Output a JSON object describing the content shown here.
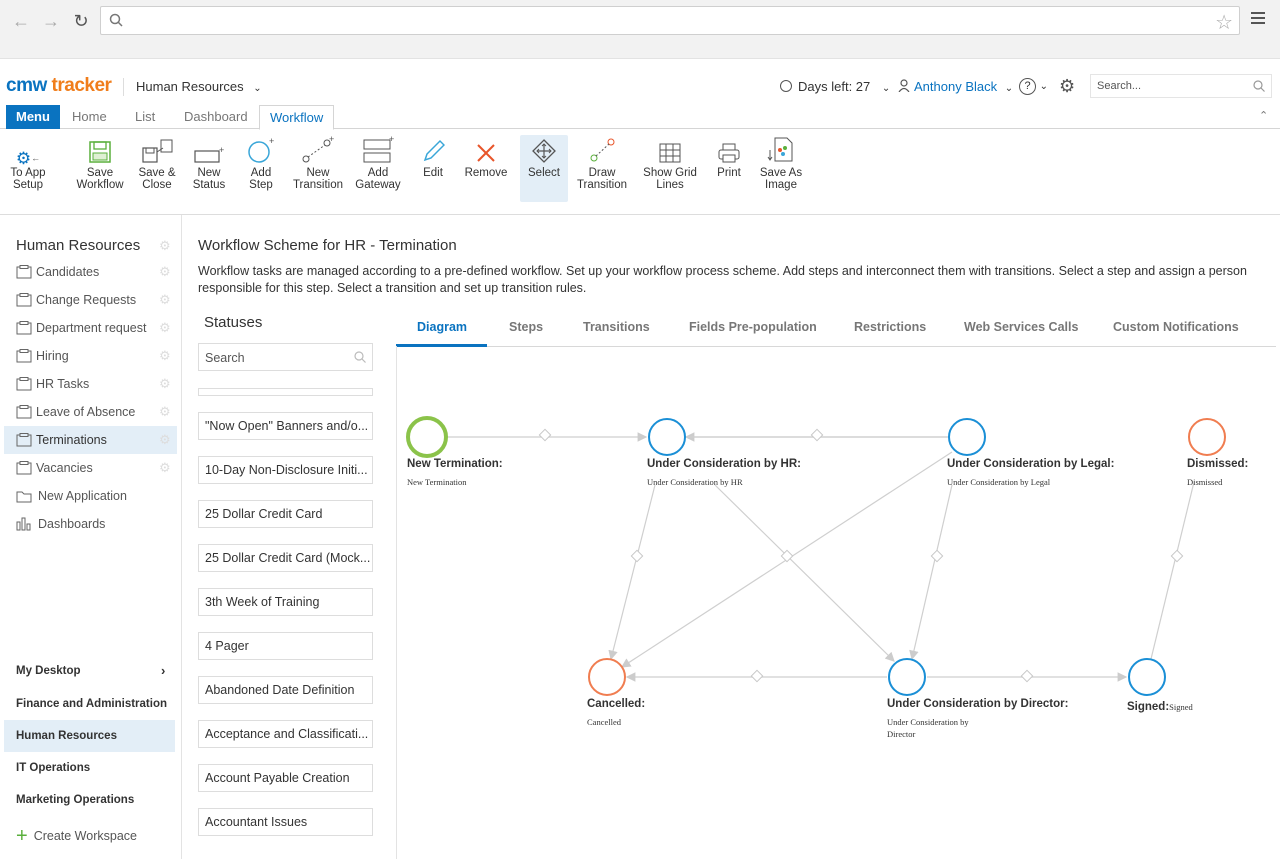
{
  "browser": {
    "url": ""
  },
  "header": {
    "logo_part1": "cmw",
    "logo_part2": "tracker",
    "workspace": "Human Resources",
    "days_left": "Days left: 27",
    "user": "Anthony Black",
    "search_placeholder": "Search..."
  },
  "tabs": [
    {
      "label": "Menu"
    },
    {
      "label": "Home"
    },
    {
      "label": "List"
    },
    {
      "label": "Dashboard"
    },
    {
      "label": "Workflow"
    }
  ],
  "toolbar": [
    {
      "line1": "To App",
      "line2": "Setup",
      "icon": "gear-back-icon"
    },
    {
      "line1": "Save",
      "line2": "Workflow",
      "icon": "save-icon"
    },
    {
      "line1": "Save &",
      "line2": "Close",
      "icon": "save-close-icon"
    },
    {
      "line1": "New",
      "line2": "Status",
      "icon": "new-status-icon"
    },
    {
      "line1": "Add",
      "line2": "Step",
      "icon": "add-step-icon"
    },
    {
      "line1": "New",
      "line2": "Transition",
      "icon": "new-transition-icon"
    },
    {
      "line1": "Add",
      "line2": "Gateway",
      "icon": "add-gateway-icon"
    },
    {
      "line1": "Edit",
      "line2": "",
      "icon": "pencil-icon"
    },
    {
      "line1": "Remove",
      "line2": "",
      "icon": "remove-icon"
    },
    {
      "line1": "Select",
      "line2": "",
      "icon": "select-icon"
    },
    {
      "line1": "Draw",
      "line2": "Transition",
      "icon": "draw-transition-icon"
    },
    {
      "line1": "Show Grid",
      "line2": "Lines",
      "icon": "grid-icon"
    },
    {
      "line1": "Print",
      "line2": "",
      "icon": "print-icon"
    },
    {
      "line1": "Save As",
      "line2": "Image",
      "icon": "save-image-icon"
    }
  ],
  "sidebar": {
    "title": "Human Resources",
    "items": [
      {
        "label": "Candidates"
      },
      {
        "label": "Change Requests"
      },
      {
        "label": "Department request"
      },
      {
        "label": "Hiring"
      },
      {
        "label": "HR Tasks"
      },
      {
        "label": "Leave of Absence"
      },
      {
        "label": "Terminations"
      },
      {
        "label": "Vacancies"
      },
      {
        "label": "New Application"
      },
      {
        "label": "Dashboards"
      }
    ],
    "workspaces": [
      {
        "label": "My Desktop"
      },
      {
        "label": "Finance and Administration"
      },
      {
        "label": "Human Resources"
      },
      {
        "label": "IT Operations"
      },
      {
        "label": "Marketing Operations"
      }
    ],
    "create_workspace": "Create Workspace"
  },
  "main": {
    "title": "Workflow Scheme for HR - Termination",
    "description": "Workflow tasks are managed according to a pre-defined workflow. Set up your workflow process scheme. Add steps and interconnect them with transitions. Select a step and assign a person responsible for this step. Select a transition and set up transition rules."
  },
  "statuses": {
    "title": "Statuses",
    "search_placeholder": "Search",
    "items": [
      "\"Now Open\" Banners and/o...",
      "10-Day Non-Disclosure Initi...",
      "25 Dollar Credit Card",
      "25 Dollar Credit Card (Mock...",
      "3th Week of Training",
      "4 Pager",
      "Abandoned Date Definition",
      "Acceptance and Classificati...",
      "Account Payable Creation",
      "Accountant Issues"
    ]
  },
  "diagram_tabs": [
    {
      "label": "Diagram"
    },
    {
      "label": "Steps"
    },
    {
      "label": "Transitions"
    },
    {
      "label": "Fields Pre-population"
    },
    {
      "label": "Restrictions"
    },
    {
      "label": "Web Services Calls"
    },
    {
      "label": "Custom Notifications"
    }
  ],
  "diagram": {
    "nodes": [
      {
        "title": "New Termination:",
        "sub": "New Termination",
        "kind": "start"
      },
      {
        "title": "Under Consideration by HR:",
        "sub": "Under Consideration by HR",
        "kind": "step"
      },
      {
        "title": "Under Consideration by Legal:",
        "sub": "Under Consideration by Legal",
        "kind": "step"
      },
      {
        "title": "Dismissed:",
        "sub": "Dismissed",
        "kind": "end"
      },
      {
        "title": "Cancelled:",
        "sub": "Cancelled",
        "kind": "end"
      },
      {
        "title": "Under Consideration by Director:",
        "sub": "Under Consideration by",
        "sub2": "Director",
        "kind": "step"
      },
      {
        "title": "Signed:",
        "sub": "Signed",
        "kind": "step"
      }
    ]
  },
  "colors": {
    "accent": "#0a73c0",
    "orange": "#f07d1b",
    "start": "#8bc34a",
    "end": "#f07d50"
  }
}
